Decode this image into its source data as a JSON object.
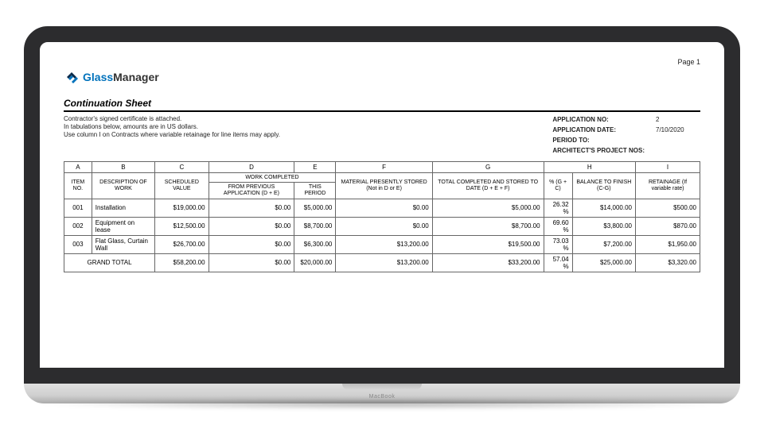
{
  "page_label": "Page 1",
  "laptop_label": "MacBook",
  "logo": {
    "brand_a": "Glass",
    "brand_b": "Manager"
  },
  "sheet_title": "Continuation Sheet",
  "notes": {
    "line1": "Contractor's signed certificate is attached.",
    "line2": "In tabulations below, amounts are in US dollars.",
    "line3": "Use column I on Contracts where variable retainage for line items may apply."
  },
  "meta": {
    "application_no_label": "APPLICATION NO:",
    "application_no_value": "2",
    "application_date_label": "APPLICATION DATE:",
    "application_date_value": "7/10/2020",
    "period_to_label": "PERIOD TO:",
    "period_to_value": "",
    "architect_nos_label": "ARCHITECT'S PROJECT NOS:",
    "architect_nos_value": ""
  },
  "cols": {
    "A": "A",
    "B": "B",
    "C": "C",
    "D": "D",
    "E": "E",
    "F": "F",
    "G": "G",
    "H": "H",
    "I": "I"
  },
  "headers": {
    "item_no": "ITEM NO.",
    "description": "DESCRIPTION OF WORK",
    "scheduled_value": "SCHEDULED VALUE",
    "work_completed": "WORK COMPLETED",
    "from_prev": "FROM PREVIOUS APPLICATION (D + E)",
    "this_period": "THIS PERIOD",
    "material": "MATERIAL PRESENTLY STORED (Not in D or E)",
    "total_completed": "TOTAL COMPLETED AND STORED TO DATE (D + E + F)",
    "pct": "% (G + C)",
    "balance_to_finish": "BALANCE TO FINISH (C-G)",
    "retainage": "RETAINAGE (If variable rate)"
  },
  "rows": [
    {
      "item": "001",
      "desc": "Installation",
      "sched": "$19,000.00",
      "from_prev": "$0.00",
      "this_period": "$5,000.00",
      "material": "$0.00",
      "total": "$5,000.00",
      "pct": "26.32 %",
      "balance": "$14,000.00",
      "ret": "$500.00"
    },
    {
      "item": "002",
      "desc": "Equipment on lease",
      "sched": "$12,500.00",
      "from_prev": "$0.00",
      "this_period": "$8,700.00",
      "material": "$0.00",
      "total": "$8,700.00",
      "pct": "69.60 %",
      "balance": "$3,800.00",
      "ret": "$870.00"
    },
    {
      "item": "003",
      "desc": "Flat Glass, Curtain Wall",
      "sched": "$26,700.00",
      "from_prev": "$0.00",
      "this_period": "$6,300.00",
      "material": "$13,200.00",
      "total": "$19,500.00",
      "pct": "73.03 %",
      "balance": "$7,200.00",
      "ret": "$1,950.00"
    }
  ],
  "grand_total": {
    "label": "GRAND TOTAL",
    "sched": "$58,200.00",
    "from_prev": "$0.00",
    "this_period": "$20,000.00",
    "material": "$13,200.00",
    "total": "$33,200.00",
    "pct": "57.04 %",
    "balance": "$25,000.00",
    "ret": "$3,320.00"
  }
}
